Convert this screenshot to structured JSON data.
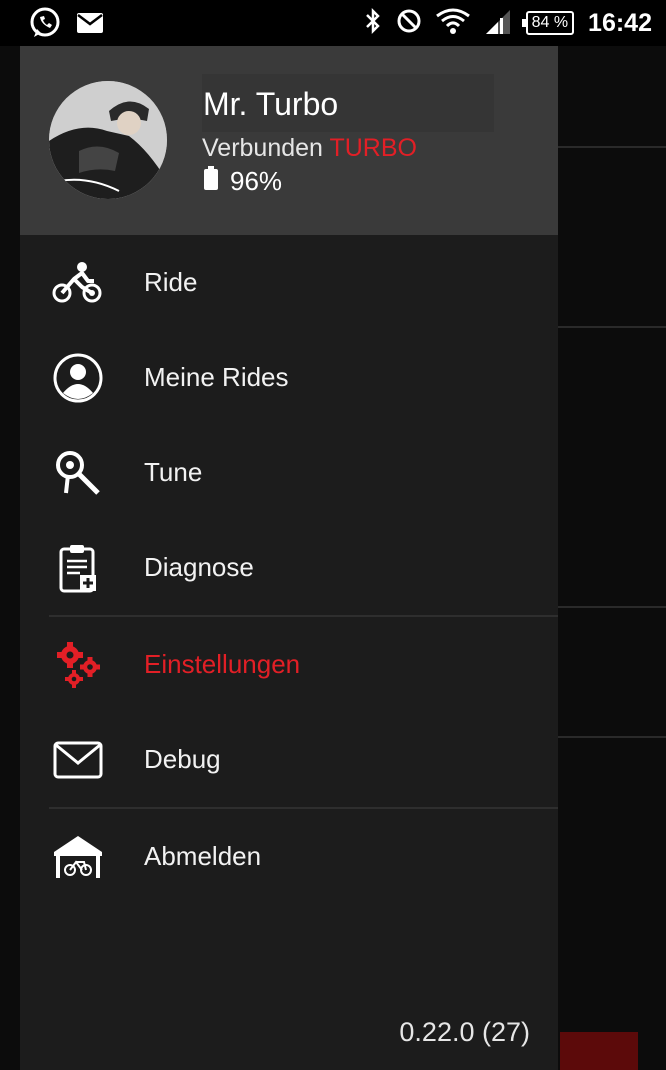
{
  "status_bar": {
    "left_icons": [
      "whatsapp-icon",
      "mail-icon"
    ],
    "right_icons": [
      "bluetooth-icon",
      "do-not-disturb-icon",
      "wifi-icon",
      "signal-icon"
    ],
    "battery": "84 %",
    "time": "16:42"
  },
  "drawer": {
    "user_name": "Mr. Turbo",
    "connection_label": "Verbunden",
    "connection_status": "TURBO",
    "device_battery": "96%",
    "items": [
      {
        "label": "Ride",
        "icon": "cyclist-icon",
        "active": false
      },
      {
        "label": "Meine Rides",
        "icon": "profile-icon",
        "active": false
      },
      {
        "label": "Tune",
        "icon": "tune-wrench-icon",
        "active": false
      },
      {
        "label": "Diagnose",
        "icon": "clipboard-plus-icon",
        "active": false
      },
      {
        "label": "Einstellungen",
        "icon": "gears-icon",
        "active": true
      },
      {
        "label": "Debug",
        "icon": "envelope-icon",
        "active": false
      },
      {
        "label": "Abmelden",
        "icon": "bike-garage-icon",
        "active": false
      }
    ],
    "version": "0.22.0 (27)"
  },
  "colors": {
    "accent": "#e21f26",
    "drawer_bg": "#1c1c1c",
    "header_bg": "#3a3a3a"
  }
}
